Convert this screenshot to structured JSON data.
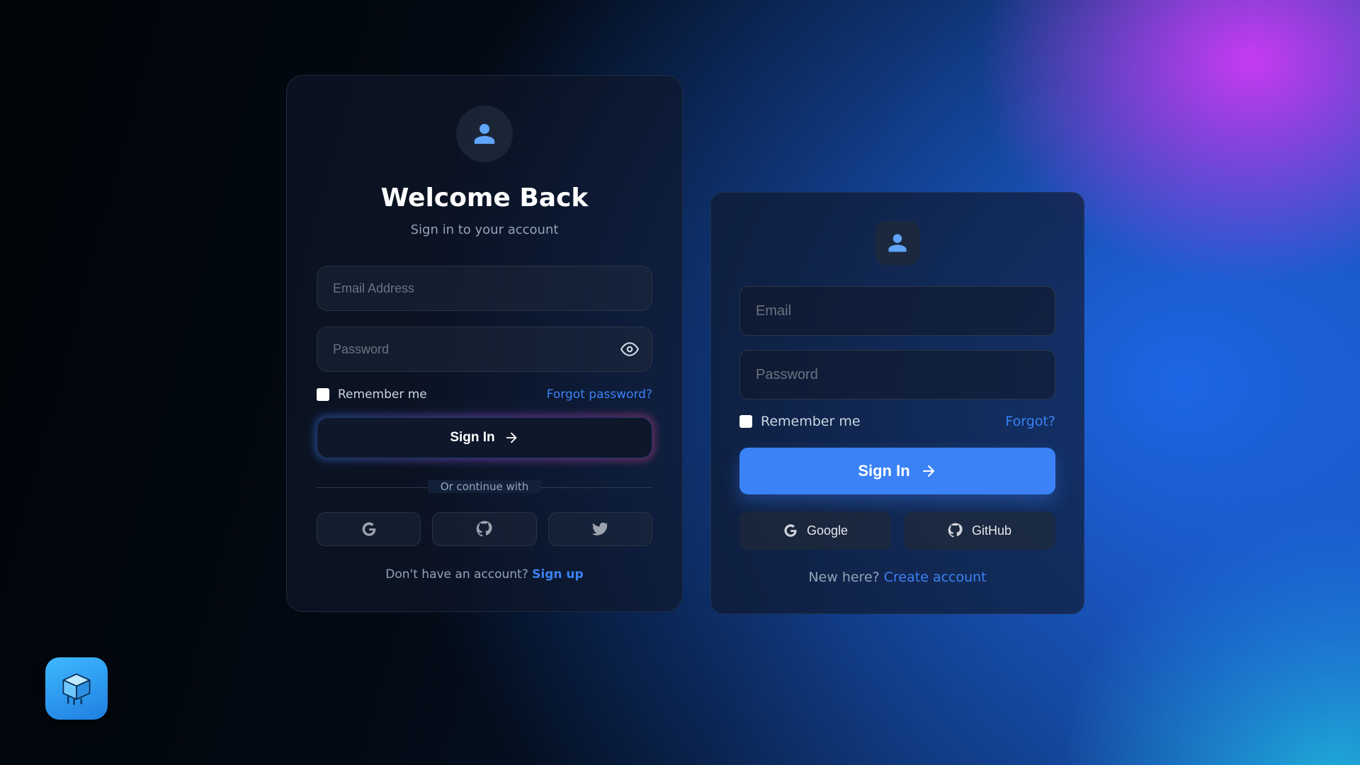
{
  "card1": {
    "title": "Welcome Back",
    "subtitle": "Sign in to your account",
    "email_placeholder": "Email Address",
    "password_placeholder": "Password",
    "remember_label": "Remember me",
    "forgot_label": "Forgot password?",
    "signin_label": "Sign In",
    "divider_label": "Or continue with",
    "social_icons": [
      "google-icon",
      "github-icon",
      "twitter-icon"
    ],
    "footer_text": "Don't have an account? ",
    "footer_link": "Sign up"
  },
  "card2": {
    "email_placeholder": "Email",
    "password_placeholder": "Password",
    "remember_label": "Remember me",
    "forgot_label": "Forgot?",
    "signin_label": "Sign In",
    "social": {
      "google": "Google",
      "github": "GitHub"
    },
    "footer_text": "New here? ",
    "footer_link": "Create account"
  },
  "colors": {
    "accent": "#3b82f6",
    "icon_user": "#60a5fa",
    "text_muted": "#94a3b8",
    "icon_muted": "#9ca3af"
  }
}
